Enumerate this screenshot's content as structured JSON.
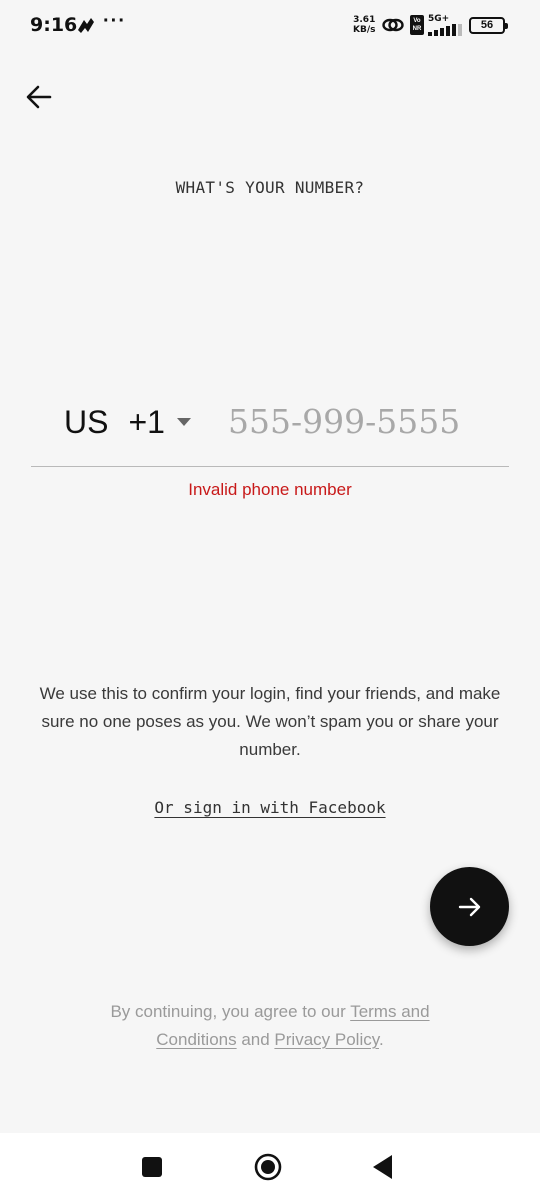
{
  "status_bar": {
    "time": "9:16",
    "dots": "···",
    "speed_value": "3.61",
    "speed_unit": "KB/s",
    "vonr": "Vo NR",
    "network": "5G+",
    "battery": "56"
  },
  "header": {
    "back_icon": "arrow-left-icon",
    "title": "WHAT'S YOUR NUMBER?"
  },
  "phone": {
    "country": "US",
    "dial_code": "+1",
    "value": "",
    "placeholder": "555-999-5555",
    "error": "Invalid phone number"
  },
  "info": {
    "text": "We use this to confirm your login, find your friends, and make sure no one poses as you. We won’t spam you or share your number."
  },
  "facebook_link": "Or sign in with Facebook",
  "next_button": {
    "icon": "arrow-right-icon"
  },
  "legal": {
    "prefix": "By continuing, you agree to our ",
    "terms": "Terms and Conditions",
    "middle": " and ",
    "privacy": "Privacy Policy",
    "suffix": "."
  },
  "nav_bar": {
    "recents_icon": "square-icon",
    "home_icon": "circle-icon",
    "back_icon": "triangle-back-icon"
  },
  "colors": {
    "background": "#f6f6f6",
    "error": "#c81919",
    "button": "#111111",
    "muted": "#9a9a9a"
  }
}
